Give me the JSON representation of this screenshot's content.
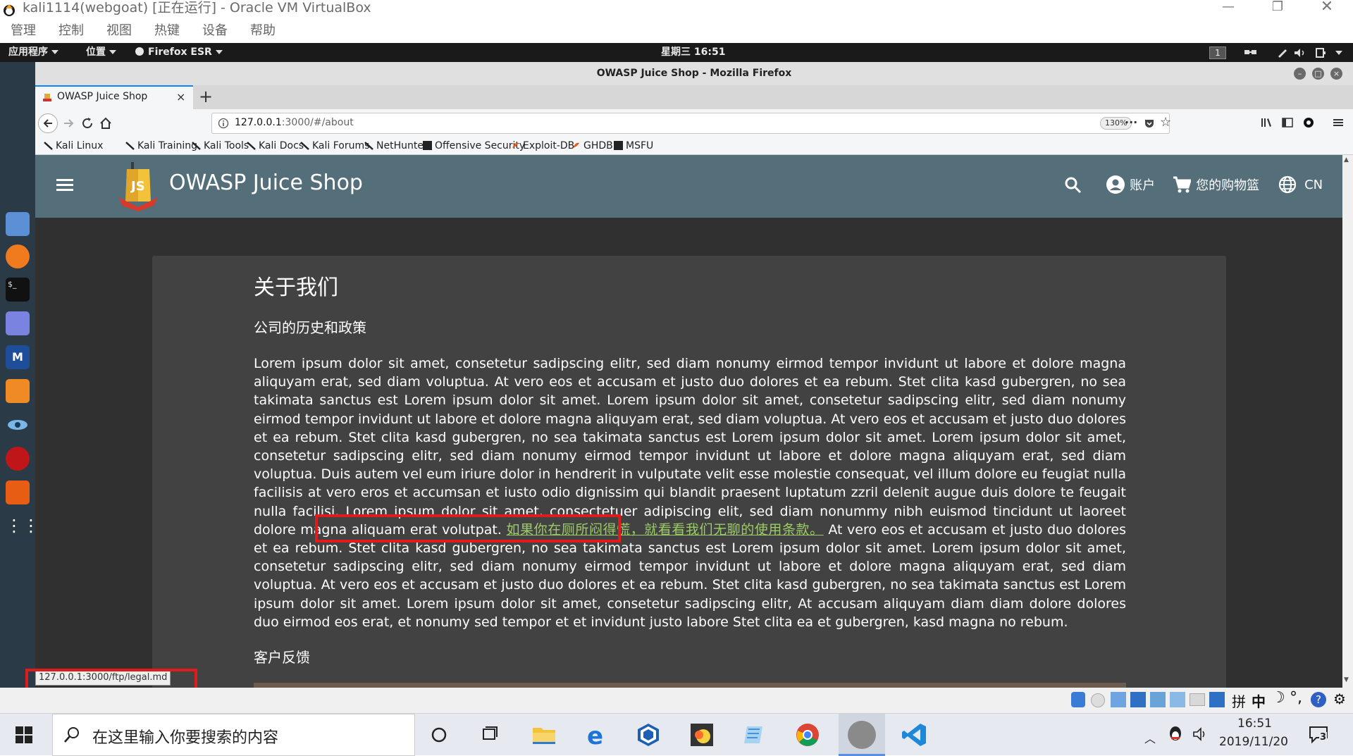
{
  "vbox": {
    "title": "kali1114(webgoat) [正在运行] - Oracle VM VirtualBox",
    "menu": [
      "管理",
      "控制",
      "视图",
      "热键",
      "设备",
      "帮助"
    ]
  },
  "kali_panel": {
    "apps": "应用程序",
    "places": "位置",
    "firefox": "Firefox ESR",
    "clock": "星期三 16:51",
    "workspace": "1"
  },
  "firefox": {
    "window_title": "OWASP Juice Shop - Mozilla Firefox",
    "tab_title": "OWASP Juice Shop",
    "url_host": "127.0.0.1",
    "url_rest": ":3000/#/about",
    "zoom": "130%",
    "bookmarks": [
      "Kali Linux",
      "Kali Training",
      "Kali Tools",
      "Kali Docs",
      "Kali Forums",
      "NetHunter",
      "Offensive Security",
      "Exploit-DB",
      "GHDB",
      "MSFU"
    ]
  },
  "juice": {
    "app_title": "OWASP Juice Shop",
    "account": "账户",
    "basket": "您的购物篮",
    "language": "CN",
    "page_title": "关于我们",
    "subtitle": "公司的历史和政策",
    "text_before": "Lorem ipsum dolor sit amet, consetetur sadipscing elitr, sed diam nonumy eirmod tempor invidunt ut labore et dolore magna aliquyam erat, sed diam voluptua. At vero eos et accusam et justo duo dolores et ea rebum. Stet clita kasd gubergren, no sea takimata sanctus est Lorem ipsum dolor sit amet. Lorem ipsum dolor sit amet, consetetur sadipscing elitr, sed diam nonumy eirmod tempor invidunt ut labore et dolore magna aliquyam erat, sed diam voluptua. At vero eos et accusam et justo duo dolores et ea rebum. Stet clita kasd gubergren, no sea takimata sanctus est Lorem ipsum dolor sit amet. Lorem ipsum dolor sit amet, consetetur sadipscing elitr, sed diam nonumy eirmod tempor invidunt ut labore et dolore magna aliquyam erat, sed diam voluptua. Duis autem vel eum iriure dolor in hendrerit in vulputate velit esse molestie consequat, vel illum dolore eu feugiat nulla facilisis at vero eros et accumsan et iusto odio dignissim qui blandit praesent luptatum zzril delenit augue duis dolore te feugait nulla facilisi. Lorem ipsum dolor sit amet, consectetuer adipiscing elit, sed diam nonummy nibh euismod tincidunt ut laoreet dolore magna aliquam erat volutpat. ",
    "legal_link": "如果你在厕所闷得慌，就看看我们无聊的使用条款。",
    "text_after": " At vero eos et accusam et justo duo dolores et ea rebum. Stet clita kasd gubergren, no sea takimata sanctus est Lorem ipsum dolor sit amet. Lorem ipsum dolor sit amet, consetetur sadipscing elitr, sed diam nonumy eirmod tempor invidunt ut labore et dolore magna aliquyam erat, sed diam voluptua. At vero eos et accusam et justo duo dolores et ea rebum. Stet clita kasd gubergren, no sea takimata sanctus est Lorem ipsum dolor sit amet. Lorem ipsum dolor sit amet, consetetur sadipscing elitr, At accusam aliquyam diam diam dolore dolores duo eirmod eos erat, et nonumy sed tempor et et invidunt justo labore Stet clita ea et gubergren, kasd magna no rebum.",
    "feedback_title": "客户反馈"
  },
  "status_url": "127.0.0.1:3000/ftp/legal.md",
  "taskbar": {
    "search_placeholder": "在这里输入你要搜索的内容",
    "time": "16:51",
    "date": "2019/11/20",
    "ime": "中",
    "ime_mode": "拼",
    "notifications": "3"
  },
  "colors": {
    "toolbar": "#546e7a",
    "page_bg": "#303030",
    "card_bg": "#424242",
    "link": "#9ccc65",
    "highlight": "#e01b1b"
  }
}
